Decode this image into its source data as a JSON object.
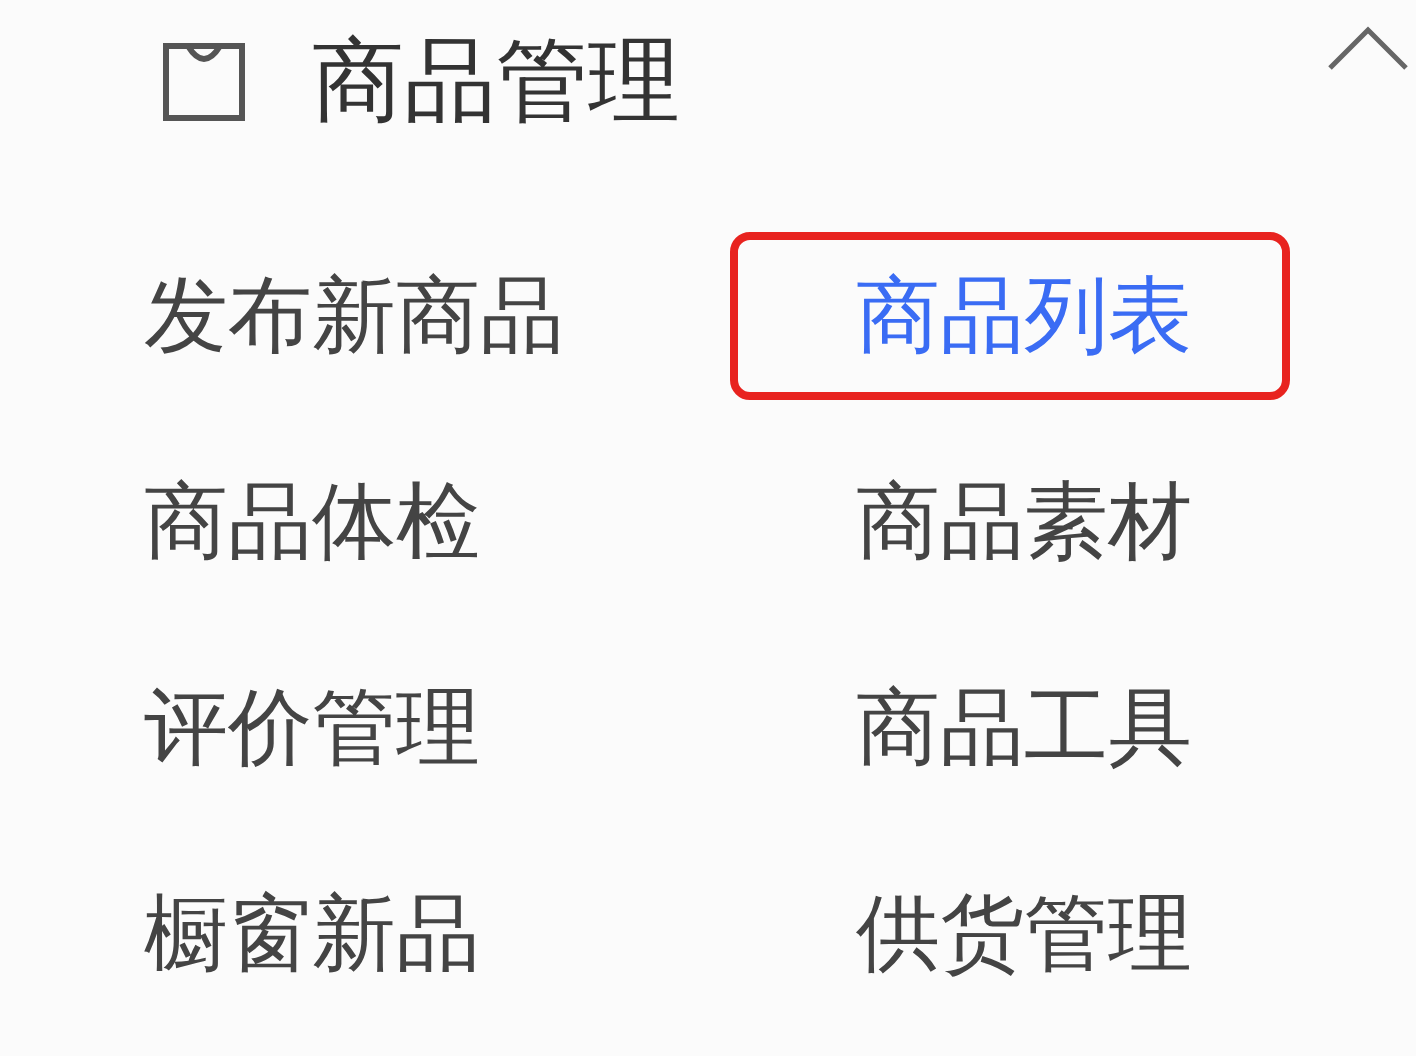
{
  "section": {
    "title": "商品管理",
    "expanded": true
  },
  "items": [
    {
      "label": "发布新商品",
      "selected": false,
      "highlighted": false
    },
    {
      "label": "商品列表",
      "selected": true,
      "highlighted": true
    },
    {
      "label": "商品体检",
      "selected": false,
      "highlighted": false
    },
    {
      "label": "商品素材",
      "selected": false,
      "highlighted": false
    },
    {
      "label": "评价管理",
      "selected": false,
      "highlighted": false
    },
    {
      "label": "商品工具",
      "selected": false,
      "highlighted": false
    },
    {
      "label": "橱窗新品",
      "selected": false,
      "highlighted": false
    },
    {
      "label": "供货管理",
      "selected": false,
      "highlighted": false
    }
  ]
}
